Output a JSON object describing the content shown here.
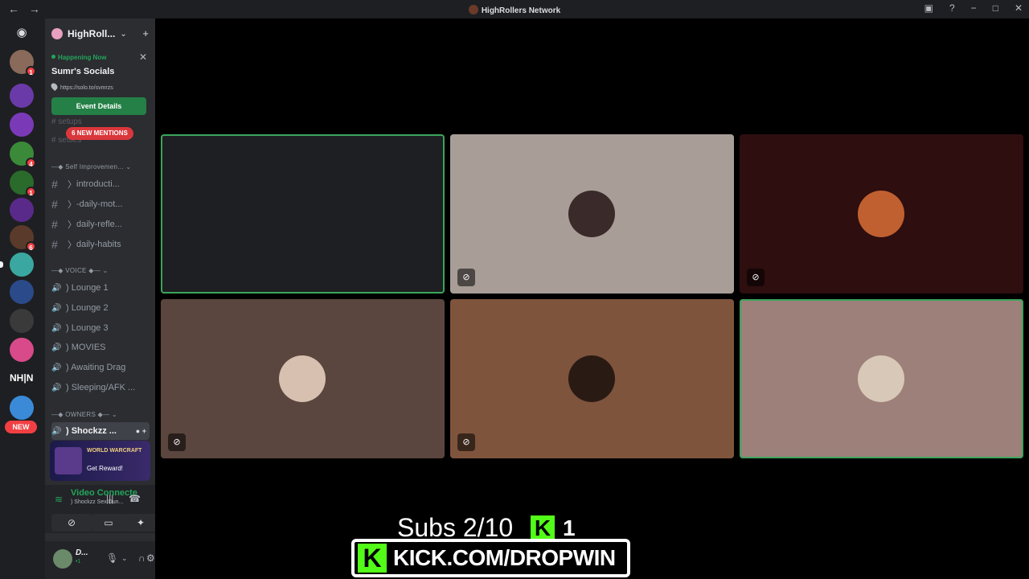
{
  "window": {
    "title": "HighRollers Network",
    "back": "←",
    "forward": "→"
  },
  "servers": {
    "items": [
      {
        "name": "server-1",
        "color": "#8a6a5a",
        "badge": "1"
      },
      {
        "name": "server-2",
        "color": "#6a3aa8",
        "badge": ""
      },
      {
        "name": "server-3",
        "color": "#7a3ab8",
        "badge": ""
      },
      {
        "name": "server-4",
        "color": "#3a8a3a",
        "badge": "4"
      },
      {
        "name": "server-5",
        "color": "#2a6a2a",
        "badge": "1"
      },
      {
        "name": "server-6",
        "color": "#5a2a8a",
        "badge": ""
      },
      {
        "name": "server-7",
        "color": "#5a3a2a",
        "badge": "6"
      },
      {
        "name": "server-8",
        "color": "#3aa8a0",
        "badge": ""
      },
      {
        "name": "server-9",
        "color": "#2a4a8a",
        "badge": ""
      },
      {
        "name": "server-10",
        "color": "#3a3a3a",
        "badge": ""
      },
      {
        "name": "server-11",
        "color": "#d84a8a",
        "badge": ""
      },
      {
        "name": "server-13",
        "color": "#3a8ad8",
        "badge": ""
      }
    ],
    "nhn_label": "NH|N",
    "new_label": "NEW"
  },
  "guild": {
    "name": "HighRoll...",
    "event": {
      "status": "Happening Now",
      "name": "Sumr's Socials",
      "location": "https://solo.to/svmrzs",
      "button": "Event Details"
    },
    "mentions": "6 NEW MENTIONS",
    "faded_channels": [
      "setups",
      "settles"
    ],
    "categories": {
      "self": "Self Improvemen...",
      "voice": "VOICE",
      "owners": "OWNERS"
    },
    "text_channels": [
      {
        "label": "introducti..."
      },
      {
        "label": "-daily-mot..."
      },
      {
        "label": "daily-refle..."
      },
      {
        "label": "daily-habits"
      }
    ],
    "voice_channels": [
      {
        "label": ") Lounge 1"
      },
      {
        "label": ") Lounge 2"
      },
      {
        "label": ") Lounge 3"
      },
      {
        "label": ") MOVIES"
      },
      {
        "label": ") Awaiting Drag"
      },
      {
        "label": ") Sleeping/AFK ..."
      }
    ],
    "active_channel": ") Shockzz ..."
  },
  "promo": {
    "title": "WORLD WARCRAFT",
    "cta": "Get Reward!"
  },
  "voice_status": {
    "title": "Video Connecte",
    "channel": ") Shockzz Sex Dun..."
  },
  "user": {
    "name": "D...",
    "status": "•1"
  },
  "tiles": [
    {
      "name": "tile-1",
      "bg": "#1e1f22",
      "speaking": true,
      "avatar": "",
      "muted": false
    },
    {
      "name": "tile-2",
      "bg": "#a89e97",
      "speaking": false,
      "avatar": "#3a2a2a",
      "muted": true
    },
    {
      "name": "tile-3",
      "bg": "#2e0e0f",
      "speaking": false,
      "avatar": "#c06030",
      "muted": true
    },
    {
      "name": "tile-4",
      "bg": "#5a463e",
      "speaking": false,
      "avatar": "#d8c0b0",
      "muted": true
    },
    {
      "name": "tile-5",
      "bg": "#7e543c",
      "speaking": false,
      "avatar": "#2a1a14",
      "muted": true
    },
    {
      "name": "tile-6",
      "bg": "#9e807a",
      "speaking": true,
      "avatar": "#d8c8b8",
      "muted": false
    }
  ],
  "overlay": {
    "subs": "Subs 2/10",
    "kick_count": "1",
    "kick_logo": "K",
    "kick_url": "KICK.COM/DROPWIN"
  }
}
